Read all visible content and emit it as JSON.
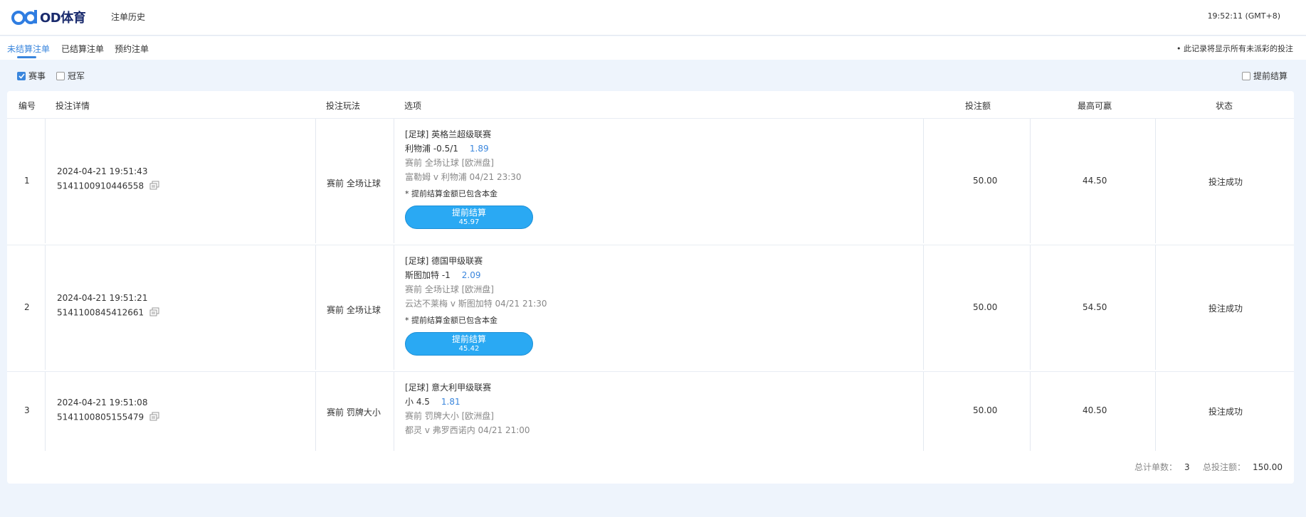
{
  "header": {
    "brand": "OD体育",
    "nav_history": "注单历史",
    "clock": "19:52:11 (GMT+8)"
  },
  "tabs": [
    {
      "label": "未结算注单",
      "active": true
    },
    {
      "label": "已结算注单",
      "active": false
    },
    {
      "label": "预约注单",
      "active": false
    }
  ],
  "notice": "• 此记录将显示所有未派彩的投注",
  "filters": {
    "match": {
      "label": "赛事",
      "checked": true
    },
    "champion": {
      "label": "冠军",
      "checked": false
    },
    "early_settle": {
      "label": "提前结算",
      "checked": false
    }
  },
  "table": {
    "headers": {
      "index": "编号",
      "detail": "投注详情",
      "play": "投注玩法",
      "option": "选项",
      "stake": "投注额",
      "max_win": "最高可赢",
      "status": "状态"
    },
    "rows": [
      {
        "index": "1",
        "time": "2024-04-21 19:51:43",
        "bet_id": "5141100910446558",
        "play": "赛前  全场让球",
        "league": "[足球] 英格兰超级联赛",
        "selection": "利物浦 -0.5/1",
        "odds": "1.89",
        "market": "赛前 全场让球 [欧洲盘]",
        "match": "富勒姆 v 利物浦    04/21 23:30",
        "note": "* 提前结算金额已包含本金",
        "cashout_label": "提前结算",
        "cashout_value": "45.97",
        "stake": "50.00",
        "max_win": "44.50",
        "status": "投注成功"
      },
      {
        "index": "2",
        "time": "2024-04-21 19:51:21",
        "bet_id": "5141100845412661",
        "play": "赛前  全场让球",
        "league": "[足球] 德国甲级联赛",
        "selection": "斯图加特 -1",
        "odds": "2.09",
        "market": "赛前 全场让球 [欧洲盘]",
        "match": "云达不莱梅 v 斯图加特    04/21 21:30",
        "note": "* 提前结算金额已包含本金",
        "cashout_label": "提前结算",
        "cashout_value": "45.42",
        "stake": "50.00",
        "max_win": "54.50",
        "status": "投注成功"
      },
      {
        "index": "3",
        "time": "2024-04-21 19:51:08",
        "bet_id": "5141100805155479",
        "play": "赛前  罚牌大小",
        "league": "[足球] 意大利甲级联赛",
        "selection": "小 4.5",
        "odds": "1.81",
        "market": "赛前 罚牌大小 [欧洲盘]",
        "match": "都灵 v 弗罗西诺内    04/21 21:00",
        "stake": "50.00",
        "max_win": "40.50",
        "status": "投注成功"
      }
    ]
  },
  "summary": {
    "count_label": "总计单数：",
    "count": "3",
    "total_label": "总投注额：",
    "total": "150.00"
  },
  "colors": {
    "accent": "#3a86dd",
    "cashout": "#2aa9f3",
    "page_bg": "#eef4fc"
  }
}
